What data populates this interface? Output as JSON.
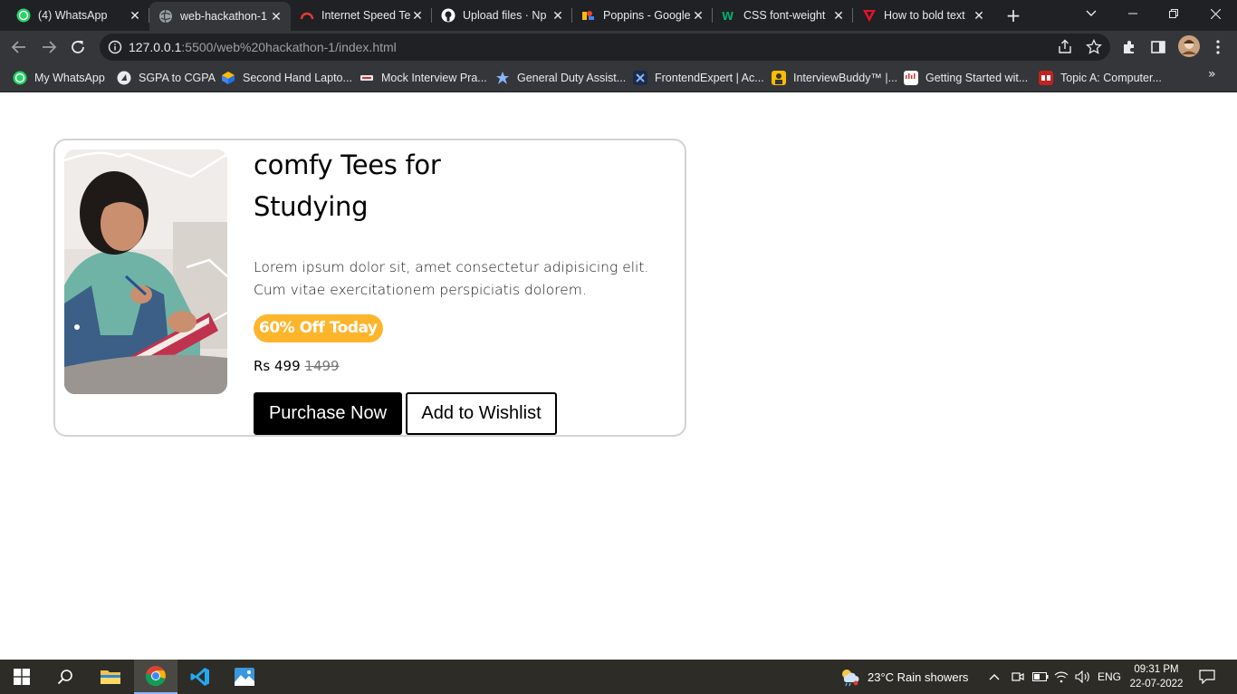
{
  "browser": {
    "tabs": [
      {
        "title": "(4) WhatsApp",
        "icon": "whatsapp-icon"
      },
      {
        "title": "web-hackathon-1",
        "icon": "globe-icon"
      },
      {
        "title": "Internet Speed Te",
        "icon": "speedtest-icon"
      },
      {
        "title": "Upload files · Np",
        "icon": "github-icon"
      },
      {
        "title": "Poppins - Google",
        "icon": "google-fonts-icon"
      },
      {
        "title": "CSS font-weight",
        "icon": "w3-icon"
      },
      {
        "title": "How to bold text",
        "icon": "stack-icon"
      }
    ],
    "url_host": "127.0.0.1",
    "url_rest": ":5500/web%20hackathon-1/index.html",
    "bookmarks": [
      {
        "label": "My WhatsApp"
      },
      {
        "label": "SGPA to CGPA"
      },
      {
        "label": "Second Hand Lapto..."
      },
      {
        "label": "Mock Interview Pra..."
      },
      {
        "label": "General Duty Assist..."
      },
      {
        "label": "FrontendExpert | Ac..."
      },
      {
        "label": "InterviewBuddy™ |..."
      },
      {
        "label": "Getting Started wit..."
      },
      {
        "label": "Topic A: Computer..."
      }
    ],
    "bookmarks_more": "»"
  },
  "product": {
    "title_line1": "comfy Tees for",
    "title_line2": "Studying",
    "description": "Lorem ipsum dolor sit, amet consectetur adipisicing elit. Cum vitae exercitationem perspiciatis dolorem.",
    "badge": "60% Off Today",
    "price": "Rs 499",
    "old_price": "1499",
    "purchase_label": "Purchase Now",
    "wishlist_label": "Add to Wishlist"
  },
  "taskbar": {
    "weather": "23°C  Rain showers",
    "language": "ENG",
    "time": "09:31 PM",
    "date": "22-07-2022"
  },
  "colors": {
    "badge": "#fdb52c",
    "tabstrip": "#202124",
    "toolbar": "#35363a",
    "taskbar": "#2d2c27"
  }
}
